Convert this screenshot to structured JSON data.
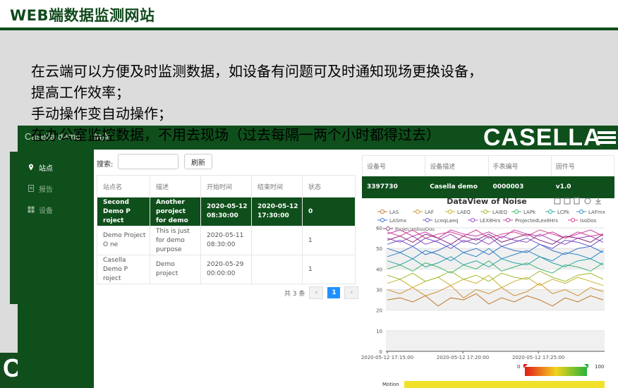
{
  "slide": {
    "title": "WEB端数据监测网站",
    "bullets": [
      "在云端可以方便及时监测数据，如设备有问题可及时通知现场更换设备，",
      "提高工作效率；",
      "手动操作变自动操作；",
      "在办公室监控数据，不用去现场（过去每隔一两个小时都得过去）"
    ],
    "corner_letter": "C"
  },
  "app": {
    "brand": "Casella demo",
    "active_tab": "站点",
    "logo": "CASELLA",
    "nav": [
      {
        "label": "站点",
        "icon": "location-pin-icon"
      },
      {
        "label": "报告",
        "icon": "document-icon"
      },
      {
        "label": "设备",
        "icon": "grid-icon"
      }
    ],
    "search": {
      "label": "搜索:",
      "value": "",
      "placeholder": ""
    },
    "refresh_label": "刷新",
    "site_table": {
      "headers": [
        "站点名",
        "描述",
        "开始时间",
        "结束时间",
        "状态"
      ],
      "rows": [
        [
          "Second Demo P roject",
          "Another poroject for demo",
          "2020-05-12 08:30:00",
          "2020-05-12 17:30:00",
          "0"
        ],
        [
          "Demo Project O ne",
          "This is just for demo purpose",
          "2020-05-11 08:30:00",
          "",
          "1"
        ],
        [
          "Casella Demo P roject",
          "Demo project",
          "2020-05-29 00:00:00",
          "",
          "1"
        ]
      ]
    },
    "pager": {
      "total": "共 3 条",
      "prev": "‹",
      "page": "1",
      "next": "›"
    },
    "device_table": {
      "headers": [
        "设备号",
        "设备描述",
        "手表编号",
        "固件号"
      ],
      "row": [
        "3397730",
        "Casella demo",
        "0000003",
        "v1.0"
      ]
    }
  },
  "chart_data": {
    "type": "line",
    "title": "DataView of Noise",
    "x": [
      "2020-05-12 17:15:00",
      "2020-05-12 17:20:00",
      "2020-05-12 17:25:00"
    ],
    "yticks": [
      0,
      10,
      20,
      30,
      40,
      50,
      60
    ],
    "ylim": [
      0,
      60
    ],
    "legend_position": "top",
    "series": [
      {
        "name": "LAS",
        "color": "#c1772c",
        "values": [
          25,
          26,
          24,
          27,
          22,
          26,
          25,
          28,
          23,
          26,
          24,
          27,
          25,
          22,
          26,
          24,
          27,
          25
        ]
      },
      {
        "name": "LAF",
        "color": "#d4902f",
        "values": [
          30,
          28,
          31,
          27,
          29,
          32,
          26,
          30,
          28,
          31,
          27,
          29,
          33,
          28,
          30,
          27,
          31,
          29
        ]
      },
      {
        "name": "LAEQ",
        "color": "#c9b12a",
        "values": [
          33,
          35,
          31,
          34,
          36,
          32,
          35,
          33,
          37,
          31,
          34,
          36,
          32,
          35,
          33,
          36,
          34,
          32
        ]
      },
      {
        "name": "LAIEQ",
        "color": "#9dbb2c",
        "values": [
          37,
          35,
          38,
          34,
          36,
          39,
          35,
          37,
          34,
          38,
          36,
          35,
          39,
          36,
          34,
          37,
          38,
          35
        ]
      },
      {
        "name": "LAPk",
        "color": "#3db36a",
        "values": [
          40,
          42,
          39,
          43,
          41,
          38,
          42,
          40,
          44,
          39,
          41,
          43,
          40,
          38,
          42,
          41,
          39,
          43
        ]
      },
      {
        "name": "LCPk",
        "color": "#2aa5a0",
        "values": [
          44,
          42,
          45,
          41,
          43,
          46,
          42,
          44,
          41,
          45,
          43,
          42,
          46,
          43,
          41,
          44,
          45,
          42
        ]
      },
      {
        "name": "LAFmx",
        "color": "#2b8cc4",
        "values": [
          46,
          48,
          45,
          49,
          47,
          44,
          48,
          46,
          50,
          45,
          47,
          49,
          46,
          44,
          48,
          47,
          45,
          49
        ]
      },
      {
        "name": "LASmx",
        "color": "#3a6fc8",
        "values": [
          50,
          48,
          51,
          47,
          49,
          52,
          48,
          50,
          47,
          51,
          49,
          48,
          52,
          49,
          47,
          50,
          51,
          48
        ]
      },
      {
        "name": "LceqLaeq",
        "color": "#6a55c4",
        "values": [
          52,
          54,
          51,
          55,
          53,
          50,
          54,
          52,
          56,
          51,
          53,
          55,
          52,
          50,
          54,
          53,
          51,
          55
        ]
      },
      {
        "name": "LEX8Hrs",
        "color": "#9a48c0",
        "values": [
          55,
          53,
          56,
          52,
          54,
          57,
          53,
          55,
          52,
          56,
          54,
          53,
          57,
          54,
          52,
          55,
          56,
          53
        ]
      },
      {
        "name": "ProjectedLex8Hrs",
        "color": "#c13ca8",
        "values": [
          57,
          59,
          56,
          58,
          55,
          59,
          57,
          56,
          58,
          55,
          59,
          57,
          56,
          58,
          55,
          57,
          59,
          56
        ]
      },
      {
        "name": "IsoDos",
        "color": "#d43e8a",
        "values": [
          58,
          56,
          59,
          55,
          57,
          58,
          56,
          59,
          55,
          57,
          58,
          56,
          59,
          57,
          55,
          58,
          56,
          57
        ]
      },
      {
        "name": "ProjectedIsoDos",
        "color": "#8c2f7a",
        "values": [
          54,
          56,
          53,
          57,
          55,
          52,
          56,
          54,
          57,
          53,
          55,
          57,
          54,
          52,
          56,
          55,
          53,
          57
        ]
      }
    ],
    "colorbar": {
      "min": "0",
      "max": "100"
    },
    "motion_label": "Motion"
  }
}
